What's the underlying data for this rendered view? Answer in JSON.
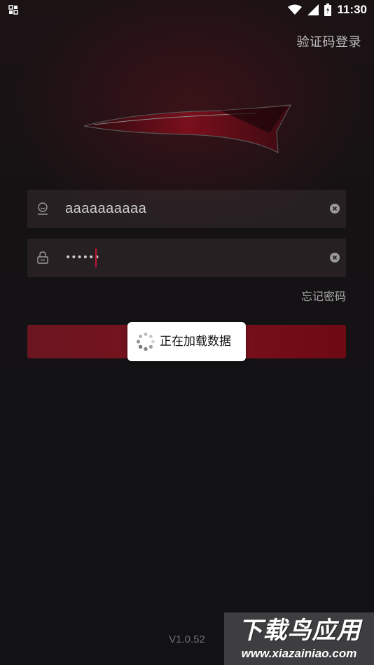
{
  "status_bar": {
    "time": "11:30",
    "icons": [
      "notification-icon",
      "wifi-icon",
      "signal-icon",
      "battery-icon"
    ]
  },
  "header": {
    "sms_login_label": "验证码登录"
  },
  "login_form": {
    "username": {
      "value": "aaaaaaaaaa",
      "icon": "user-icon"
    },
    "password": {
      "masked_value": "••••••",
      "icon": "lock-icon"
    },
    "clear_icon": "clear-icon",
    "forgot_password_label": "忘记密码"
  },
  "loading_dialog": {
    "text": "正在加载数据"
  },
  "footer": {
    "version": "V1.0.52"
  },
  "watermark": {
    "title": "下载鸟应用",
    "url": "www.xiazainiao.com"
  },
  "colors": {
    "background": "#121214",
    "accent_red": "#7a121d",
    "caret": "#c0133a",
    "text_light": "#cfcfcf",
    "text_muted": "#a6a6a6"
  }
}
